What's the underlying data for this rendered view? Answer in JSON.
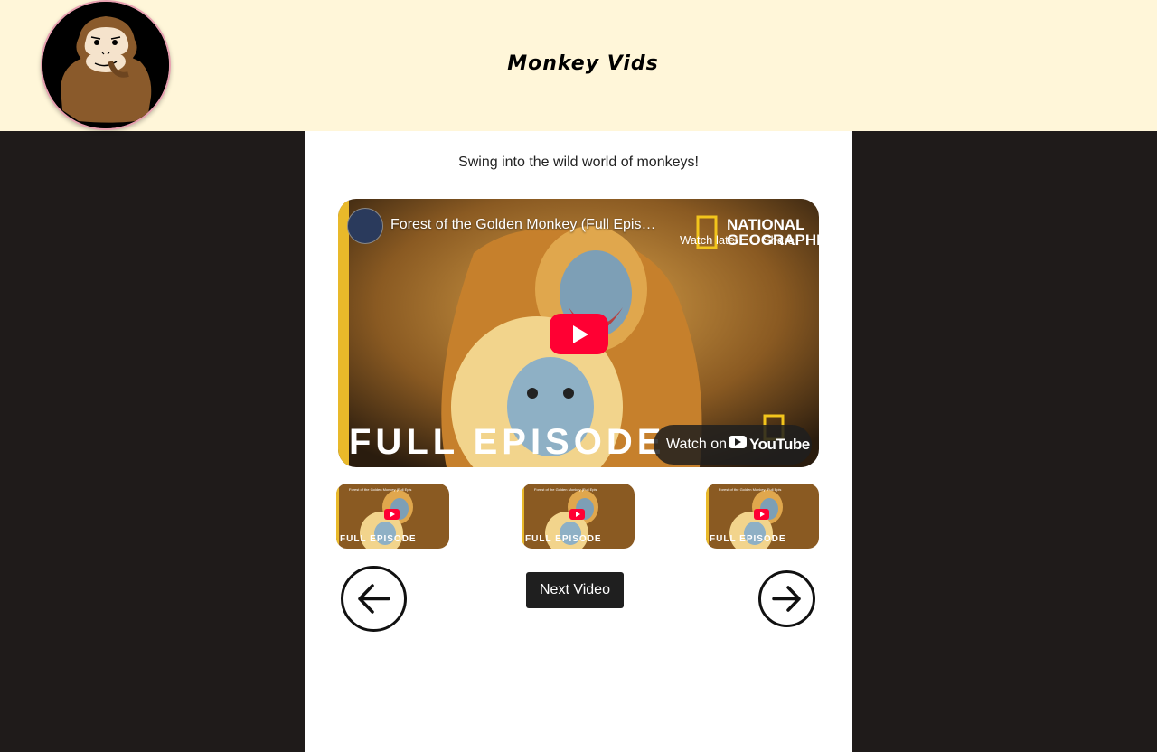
{
  "header": {
    "site_title": "Monkey Vids",
    "logo_icon": "monkey-face-icon"
  },
  "main": {
    "tagline": "Swing into the wild world of monkeys!",
    "player": {
      "video_title": "Forest of the Golden Monkey (Full Epis…",
      "watch_later_label": "Watch later",
      "share_label": "Share",
      "channel_logo_text": "NATIONAL GEOGRAPHIC",
      "overlay_text": "FULL EPISODE",
      "watch_on_label": "Watch on",
      "youtube_label": "YouTube"
    },
    "thumbnails": [
      {
        "overlay_text": "FULL EPISODE",
        "title": "Forest of the Golden Monkey (Full Epis"
      },
      {
        "overlay_text": "FULL EPISODE",
        "title": "Forest of the Golden Monkey (Full Epis"
      },
      {
        "overlay_text": "FULL EPISODE",
        "title": "Forest of the Golden Monkey (Full Epis"
      }
    ],
    "controls": {
      "prev_icon": "arrow-left-icon",
      "next_icon": "arrow-right-icon",
      "next_video_label": "Next Video"
    }
  },
  "colors": {
    "header_bg": "#fff6d9",
    "page_bg": "#1f1b1a",
    "panel_bg": "#ffffff",
    "youtube_red": "#ff0033",
    "logo_border": "#e8a0b0"
  }
}
